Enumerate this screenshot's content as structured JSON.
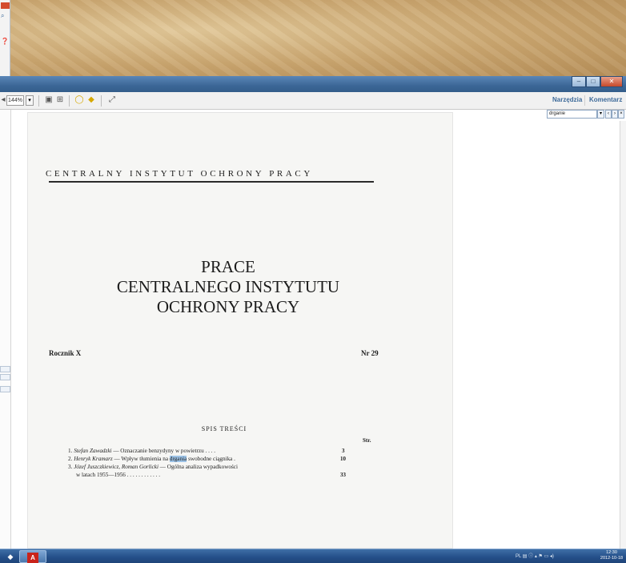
{
  "desktop": {},
  "toolbar": {
    "zoom_value": "144%",
    "zoom_arrow": "▾",
    "tools_link": "Narzędzia",
    "comment_link": "Komentarz",
    "icons": [
      "save-icon",
      "print-icon",
      "comment-icon",
      "highlight-icon",
      "expand-icon"
    ]
  },
  "find": {
    "query": "drganie",
    "prev": "‹",
    "next": "›",
    "close": "×"
  },
  "document": {
    "header": "CENTRALNY INSTYTUT OCHRONY PRACY",
    "title_line1": "PRACE",
    "title_line2": "CENTRALNEGO INSTYTUTU",
    "title_line3": "OCHRONY PRACY",
    "volume": "Rocznik X",
    "issue": "Nr 29",
    "toc_title": "SPIS TREŚCI",
    "str_label": "Str.",
    "toc": [
      {
        "num": "1.",
        "author": "Stefan Zawadzki",
        "before": " — Oznaczanie benzydyny w powietrzu",
        "highlight": "",
        "after": "",
        "dots": " . . . .",
        "page": "3"
      },
      {
        "num": "2.",
        "author": "Henryk Kramarz",
        "before": " — Wpływ tłumienia na ",
        "highlight": "drgania",
        "after": " swobodne ciągnika",
        "dots": " .",
        "page": "10"
      },
      {
        "num": "3.",
        "author": "Józef Juszczkiewicz, Roman Gorlicki",
        "before": " — Ogólna analiza wypadkowości",
        "highlight": "",
        "after": "",
        "dots": "",
        "page": ""
      },
      {
        "num": "",
        "author": "",
        "before": "w latach 1955—1956",
        "highlight": "",
        "after": "",
        "dots": " . . . . . . . . . . . .",
        "page": "33"
      }
    ]
  },
  "taskbar": {
    "pdf_app_label": "A",
    "tray_lang": "PL",
    "clock_time": "12:30",
    "clock_date": "2012-10-18"
  }
}
